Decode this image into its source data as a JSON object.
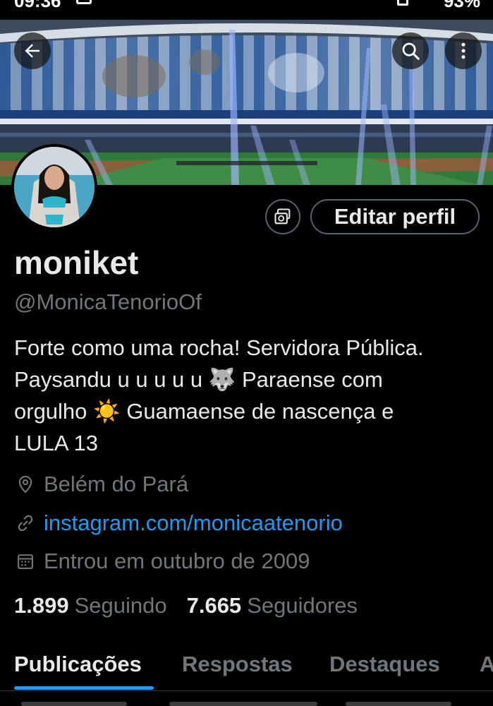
{
  "status_bar": {
    "time": "09:36",
    "battery": "93%"
  },
  "profile": {
    "display_name": "moniket",
    "handle": "@MonicaTenorioOf",
    "bio_lines": [
      "Forte como uma rocha! Servidora Pública.",
      "Paysandu u u u u u 🐺 Paraense com",
      "orgulho ☀️ Guamaense de nascença e",
      "LULA 13"
    ],
    "location": "Belém do Pará",
    "website": "instagram.com/monicaatenorio",
    "joined": "Entrou em outubro de 2009",
    "following_count": "1.899",
    "following_label": "Seguindo",
    "followers_count": "7.665",
    "followers_label": "Seguidores"
  },
  "actions": {
    "edit_profile_label": "Editar perfil"
  },
  "tabs": [
    {
      "label": "Publicações",
      "active": true
    },
    {
      "label": "Respostas",
      "active": false
    },
    {
      "label": "Destaques",
      "active": false
    },
    {
      "label": "A",
      "active": false
    }
  ],
  "icons": {
    "back": "arrow-left-icon",
    "search": "search-icon",
    "more": "more-vertical-icon",
    "media": "media-icon",
    "location": "location-pin-icon",
    "link": "link-icon",
    "calendar": "calendar-icon"
  },
  "colors": {
    "background": "#000000",
    "primary_text": "#e7e9ea",
    "secondary_text": "#71767b",
    "accent": "#1d9bf0",
    "border": "#536471"
  }
}
